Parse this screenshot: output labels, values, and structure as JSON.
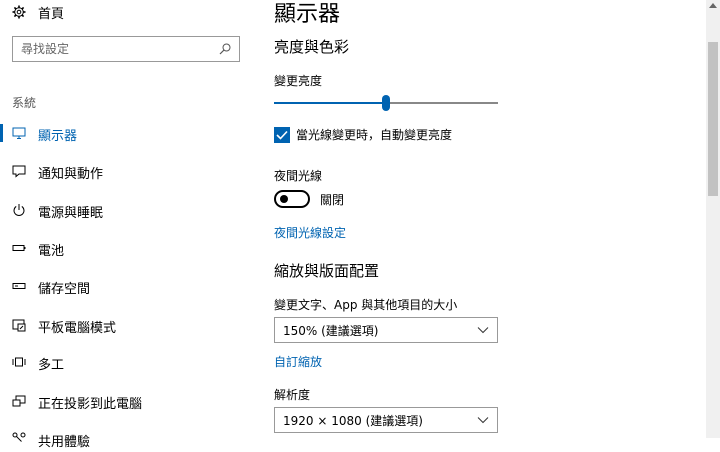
{
  "sidebar": {
    "home_label": "首頁",
    "search_placeholder": "尋找設定",
    "section_label": "系統",
    "items": [
      {
        "label": "顯示器",
        "icon": "monitor-icon",
        "active": true
      },
      {
        "label": "通知與動作",
        "icon": "notification-icon"
      },
      {
        "label": "電源與睡眠",
        "icon": "power-icon"
      },
      {
        "label": "電池",
        "icon": "battery-icon"
      },
      {
        "label": "儲存空間",
        "icon": "storage-icon"
      },
      {
        "label": "平板電腦模式",
        "icon": "tablet-mode-icon"
      },
      {
        "label": "多工",
        "icon": "multitasking-icon"
      },
      {
        "label": "正在投影到此電腦",
        "icon": "projecting-icon"
      },
      {
        "label": "共用體驗",
        "icon": "shared-experiences-icon"
      }
    ]
  },
  "main": {
    "title": "顯示器",
    "brightness_section": "亮度與色彩",
    "brightness_label": "變更亮度",
    "brightness_level": 0.5,
    "auto_brightness_label": "當光線變更時，自動變更亮度",
    "auto_brightness_checked": true,
    "night_light_label": "夜間光線",
    "night_light_state": "關閉",
    "night_light_settings_link": "夜間光線設定",
    "scale_section": "縮放與版面配置",
    "scale_label": "變更文字、App 與其他項目的大小",
    "scale_value": "150% (建議選項)",
    "custom_scaling_link": "自訂縮放",
    "resolution_label": "解析度",
    "resolution_value": "1920 × 1080 (建議選項)"
  },
  "colors": {
    "accent": "#0063b1"
  }
}
